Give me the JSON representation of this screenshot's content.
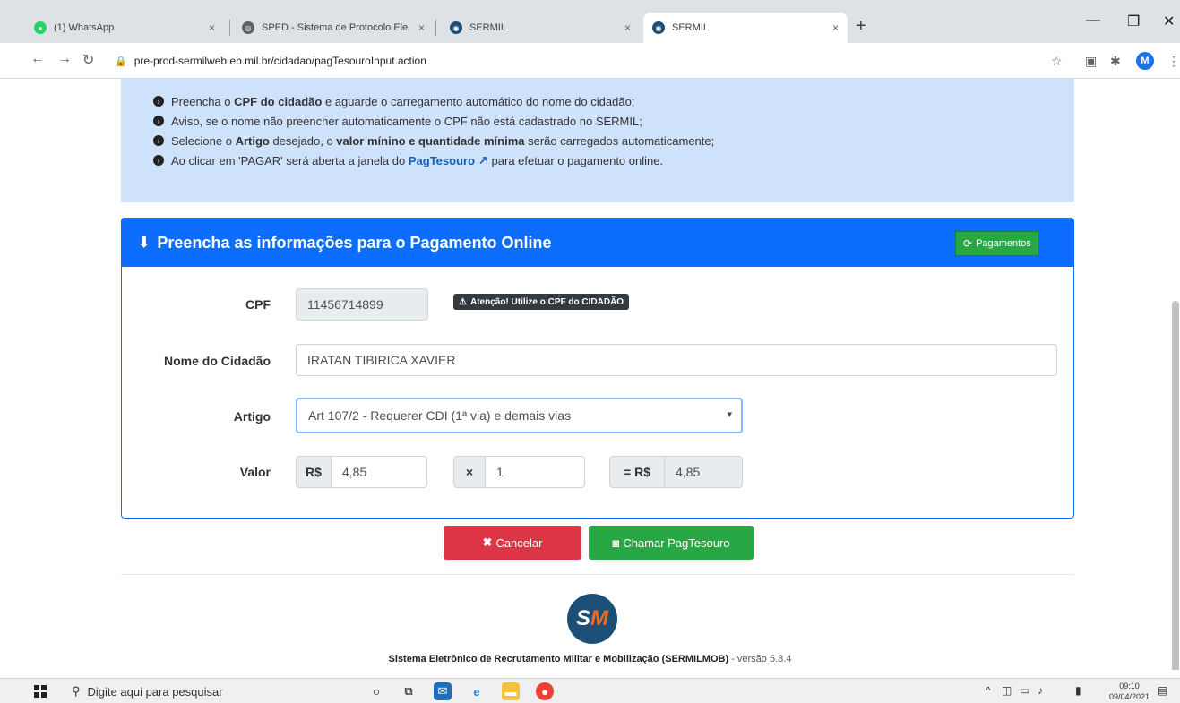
{
  "browser": {
    "tabs": [
      {
        "title": "(1) WhatsApp",
        "active": false,
        "favicon_color": "#25d366"
      },
      {
        "title": "SPED - Sistema de Protocolo Ele",
        "active": false,
        "favicon_color": "#5f6368"
      },
      {
        "title": "SERMIL",
        "active": false,
        "favicon_color": "#1d4f76"
      },
      {
        "title": "SERMIL",
        "active": true,
        "favicon_color": "#1d4f76"
      }
    ],
    "tab_close_glyph": "×",
    "new_tab_glyph": "+",
    "url": "pre-prod-sermilweb.eb.mil.br/cidadao/pagTesouroInput.action",
    "profile_initial": "M"
  },
  "info_panel": {
    "lines": [
      {
        "a": "Preencha o ",
        "b": "CPF do cidadão",
        "c": " e aguarde o carregamento automático do nome do cidadão;",
        "d": "",
        "e": ""
      },
      {
        "a": "Aviso, se o nome não preencher automaticamente o CPF não está cadastrado no SERMIL;",
        "b": "",
        "c": "",
        "d": "",
        "e": ""
      },
      {
        "a": "Selecione o ",
        "b": "Artigo",
        "c": " desejado, o ",
        "d": "valor mínino e quantidade mínima",
        "e": " serão carregados automaticamente;"
      },
      {
        "a": "Ao clicar em 'PAGAR' será aberta a janela do ",
        "b": "PagTesouro",
        "c": " para efetuar o pagamento online.",
        "d": "",
        "e": ""
      }
    ]
  },
  "form": {
    "header_title": "Preencha as informações para o Pagamento Online",
    "payments_button": "Pagamentos",
    "cpf_label": "CPF",
    "cpf_value": "11456714899",
    "cpf_warning": "Atenção! Utilize o CPF do CIDADÃO",
    "name_label": "Nome do Cidadão",
    "name_value": "IRATAN TIBIRICA XAVIER",
    "article_label": "Artigo",
    "article_selected": "Art 107/2 - Requerer CDI (1ª via) e demais vias",
    "value_label": "Valor",
    "currency_prefix": "R$",
    "unit_value": "4,85",
    "multiply_symbol": "×",
    "quantity": "1",
    "total_prefix": "= R$",
    "total_value": "4,85"
  },
  "actions": {
    "cancel_label": "Cancelar",
    "call_label": "Chamar PagTesouro"
  },
  "footer": {
    "logo_s": "S",
    "logo_m": "M",
    "system_name": "Sistema Eletrônico de Recrutamento Militar e Mobilização (SERMILMOB)",
    "version": " - versão 5.8.4"
  },
  "taskbar": {
    "search_placeholder": "Digite aqui para pesquisar",
    "time": "09:10",
    "date": "09/04/2021"
  },
  "colors": {
    "primary": "#0d6efd",
    "success": "#28a745",
    "danger": "#dc3545",
    "info_bg": "#cfe2fc"
  }
}
